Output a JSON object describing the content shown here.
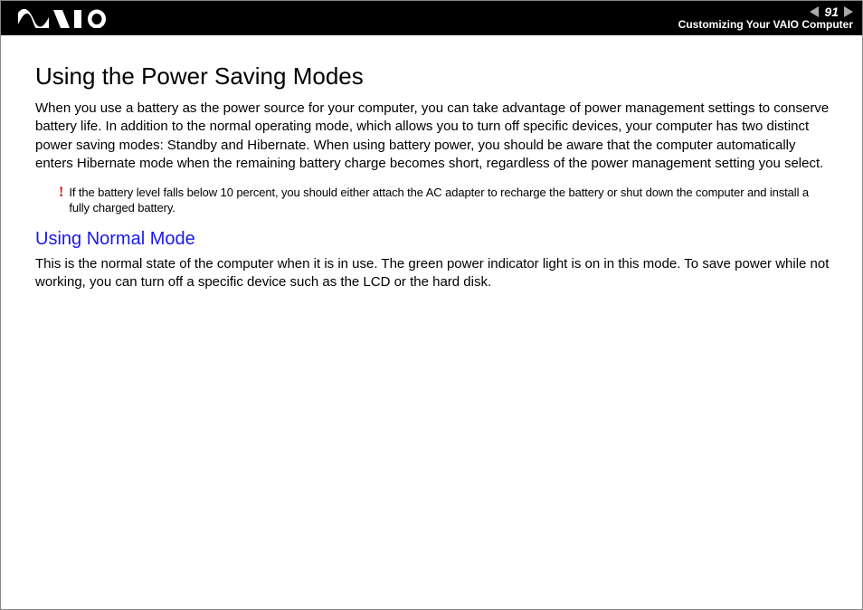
{
  "header": {
    "page_number": "91",
    "breadcrumb": "Customizing Your VAIO Computer"
  },
  "content": {
    "title": "Using the Power Saving Modes",
    "intro": "When you use a battery as the power source for your computer, you can take advantage of power management settings to conserve battery life. In addition to the normal operating mode, which allows you to turn off specific devices, your computer has two distinct power saving modes: Standby and Hibernate. When using battery power, you should be aware that the computer automatically enters Hibernate mode when the remaining battery charge becomes short, regardless of the power management setting you select.",
    "note_mark": "!",
    "note": "If the battery level falls below 10 percent, you should either attach the AC adapter to recharge the battery or shut down the computer and install a fully charged battery.",
    "subheading": "Using Normal Mode",
    "sub_body": "This is the normal state of the computer when it is in use. The green power indicator light is on in this mode. To save power while not working, you can turn off a specific device such as the LCD or the hard disk."
  }
}
